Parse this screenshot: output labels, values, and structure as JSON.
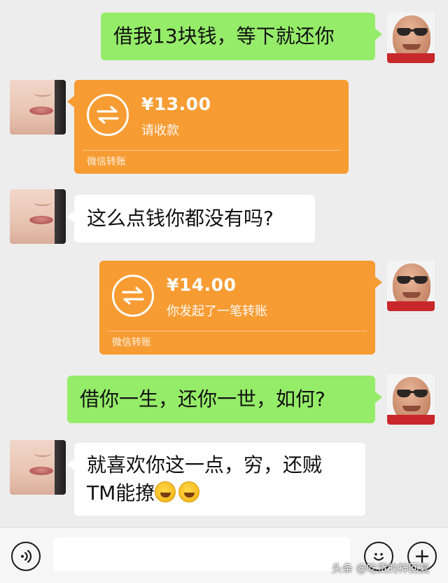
{
  "messages": [
    {
      "sender": "me",
      "type": "text",
      "text": "借我13块钱，等下就还你"
    },
    {
      "sender": "other",
      "type": "transfer",
      "amount": "¥13.00",
      "note": "请收款",
      "footer": "微信转账"
    },
    {
      "sender": "other",
      "type": "text",
      "text": "这么点钱你都没有吗?"
    },
    {
      "sender": "me",
      "type": "transfer",
      "amount": "¥14.00",
      "note": "你发起了一笔转账",
      "footer": "微信转账"
    },
    {
      "sender": "me",
      "type": "text",
      "text": "借你一生，还你一世，如何?"
    },
    {
      "sender": "other",
      "type": "text",
      "line1": "就喜欢你这一点，穷，还贼",
      "line2": "TM能撩",
      "emojis": [
        "laugh-cry-emoji",
        "laugh-cry-emoji"
      ]
    }
  ],
  "input_bar": {
    "voice_icon": "voice-icon",
    "emoji_icon": "smiley-icon",
    "more_icon": "plus-icon"
  },
  "watermark": "头条 @吃货的神回复",
  "colors": {
    "background": "#ededed",
    "my_bubble": "#95ec69",
    "other_bubble": "#ffffff",
    "transfer_card": "#f79c33"
  }
}
